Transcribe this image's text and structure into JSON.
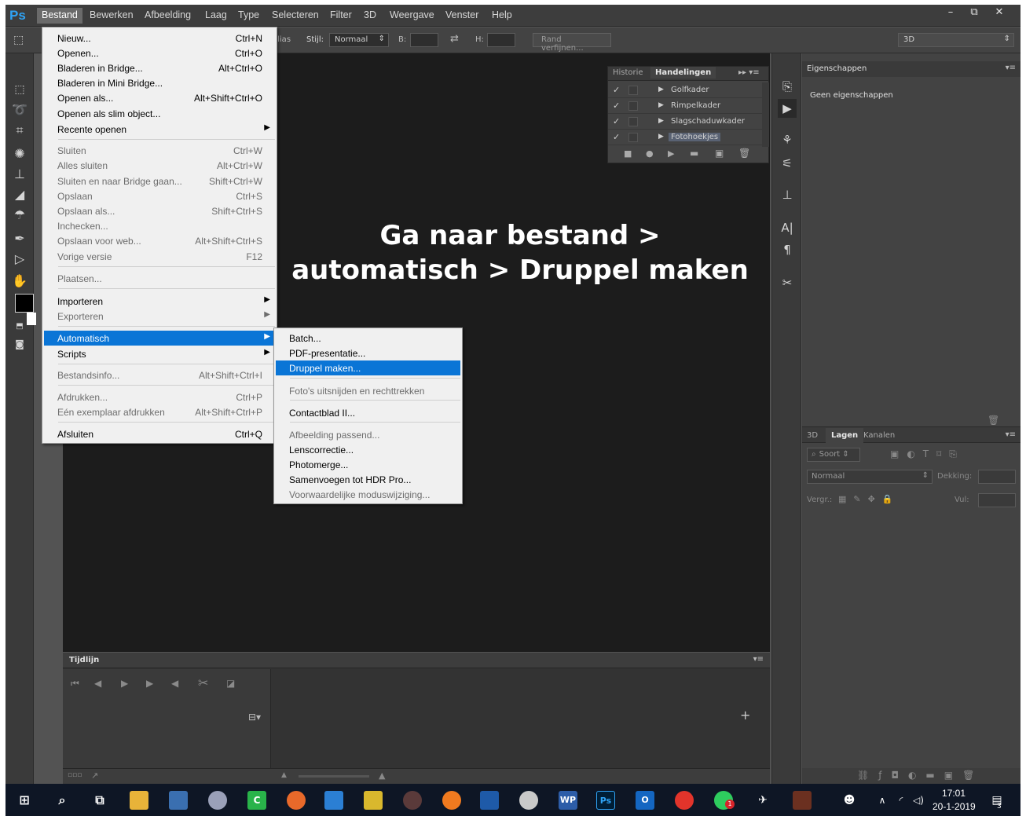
{
  "app": {
    "logo": "Ps"
  },
  "menubar": {
    "items": [
      "Bestand",
      "Bewerken",
      "Afbeelding",
      "Laag",
      "Type",
      "Selecteren",
      "Filter",
      "3D",
      "Weergave",
      "Venster",
      "Help"
    ],
    "window_controls": [
      "–",
      "⧉",
      "✕"
    ]
  },
  "options_bar": {
    "alias_label": "alias",
    "style_label": "Stijl:",
    "style_value": "Normaal",
    "width_label": "B:",
    "height_label": "H:",
    "refine_button": "Rand verfijnen...",
    "workspace_value": "3D"
  },
  "file_menu": {
    "items": [
      {
        "label": "Nieuw...",
        "shortcut": "Ctrl+N"
      },
      {
        "label": "Openen...",
        "shortcut": "Ctrl+O"
      },
      {
        "label": "Bladeren in Bridge...",
        "shortcut": "Alt+Ctrl+O"
      },
      {
        "label": "Bladeren in Mini Bridge...",
        "shortcut": ""
      },
      {
        "label": "Openen als...",
        "shortcut": "Alt+Shift+Ctrl+O"
      },
      {
        "label": "Openen als slim object...",
        "shortcut": ""
      },
      {
        "label": "Recente openen",
        "shortcut": ""
      },
      {
        "label": "Sluiten",
        "shortcut": "Ctrl+W"
      },
      {
        "label": "Alles sluiten",
        "shortcut": "Alt+Ctrl+W"
      },
      {
        "label": "Sluiten en naar Bridge gaan...",
        "shortcut": "Shift+Ctrl+W"
      },
      {
        "label": "Opslaan",
        "shortcut": "Ctrl+S"
      },
      {
        "label": "Opslaan als...",
        "shortcut": "Shift+Ctrl+S"
      },
      {
        "label": "Inchecken...",
        "shortcut": ""
      },
      {
        "label": "Opslaan voor web...",
        "shortcut": "Alt+Shift+Ctrl+S"
      },
      {
        "label": "Vorige versie",
        "shortcut": "F12"
      },
      {
        "label": "Plaatsen...",
        "shortcut": ""
      },
      {
        "label": "Importeren",
        "shortcut": ""
      },
      {
        "label": "Exporteren",
        "shortcut": ""
      },
      {
        "label": "Automatisch",
        "shortcut": ""
      },
      {
        "label": "Scripts",
        "shortcut": ""
      },
      {
        "label": "Bestandsinfo...",
        "shortcut": "Alt+Shift+Ctrl+I"
      },
      {
        "label": "Afdrukken...",
        "shortcut": "Ctrl+P"
      },
      {
        "label": "Eén exemplaar afdrukken",
        "shortcut": "Alt+Shift+Ctrl+P"
      },
      {
        "label": "Afsluiten",
        "shortcut": "Ctrl+Q"
      }
    ]
  },
  "automate_submenu": {
    "items": [
      {
        "label": "Batch..."
      },
      {
        "label": "PDF-presentatie..."
      },
      {
        "label": "Druppel maken..."
      },
      {
        "label": "Foto's uitsnijden en rechttrekken"
      },
      {
        "label": "Contactblad II..."
      },
      {
        "label": "Afbeelding passend..."
      },
      {
        "label": "Lenscorrectie..."
      },
      {
        "label": "Photomerge..."
      },
      {
        "label": "Samenvoegen tot HDR Pro..."
      },
      {
        "label": "Voorwaardelijke moduswijziging..."
      }
    ]
  },
  "canvas": {
    "overlay_line1": "Ga naar bestand >",
    "overlay_line2": "automatisch > Druppel maken"
  },
  "actions_panel": {
    "tab_history": "Historie",
    "tab_actions": "Handelingen",
    "rows": [
      "Golfkader",
      "Rimpelkader",
      "Slagschaduwkader",
      "Fotohoekjes"
    ]
  },
  "properties_panel": {
    "title": "Eigenschappen",
    "empty_text": "Geen eigenschappen"
  },
  "layers_panel": {
    "tabs": [
      "3D",
      "Lagen",
      "Kanalen"
    ],
    "filter_label": "Soort",
    "blend_mode": "Normaal",
    "opacity_label": "Dekking:",
    "lock_label": "Vergr.:",
    "fill_label": "Vul:"
  },
  "timeline": {
    "title": "Tijdlijn"
  },
  "taskbar": {
    "time": "17:01",
    "date": "20-1-2019",
    "notifications_badge": "3",
    "whatsapp_badge": "1",
    "colors": {
      "background": "#0e1625",
      "photoshop": "#001e36",
      "accent": "#2fa3f5"
    }
  }
}
